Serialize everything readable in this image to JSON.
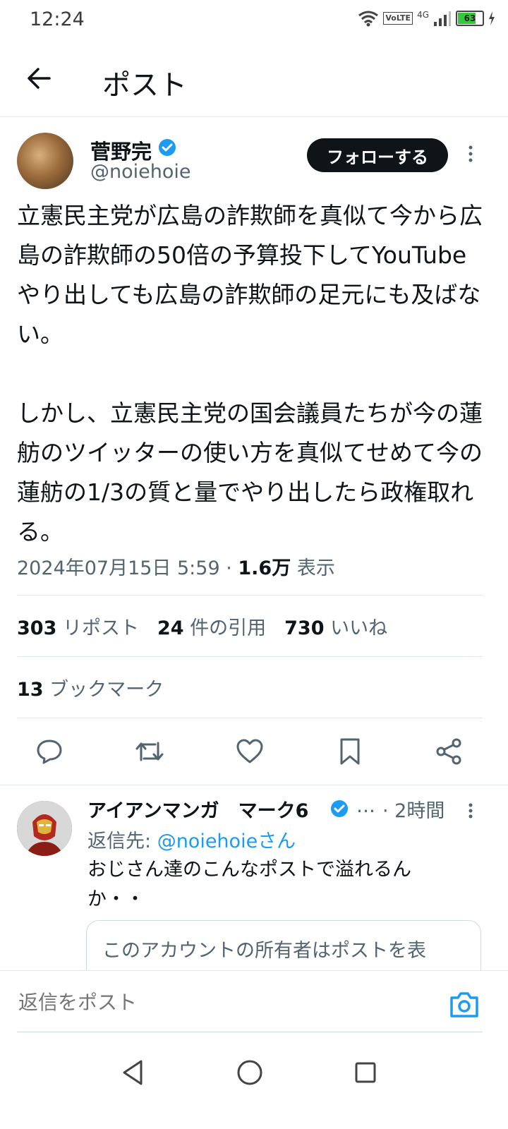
{
  "status_bar": {
    "time": "12:24",
    "network": "4G",
    "volte": "VoLTE",
    "battery": "63",
    "icons": [
      "wifi-icon",
      "signal-icon",
      "battery-icon",
      "charging-icon"
    ]
  },
  "header": {
    "title": "ポスト",
    "back_icon": "arrow-left-icon"
  },
  "post": {
    "author_name": "菅野完",
    "author_handle": "@noiehoie",
    "follow_label": "フォローする",
    "body": "立憲民主党が広島の詐欺師を真似て今から広島の詐欺師の50倍の予算投下してYouTubeやり出しても広島の詐欺師の足元にも及ばない。\n\nしかし、立憲民主党の国会議員たちが今の蓮舫のツイッターの使い方を真似てせめて今の蓮舫の1/3の質と量でやり出したら政権取れる。",
    "timestamp": "2024年07月15日 5:59",
    "separator": " · ",
    "views_count": "1.6万",
    "views_label": " 表示",
    "reposts_count": "303",
    "reposts_label": " リポスト",
    "quotes_count": "24",
    "quotes_label": " 件の引用",
    "likes_count": "730",
    "likes_label": " いいね",
    "bookmarks_count": "13",
    "bookmarks_label": " ブックマーク"
  },
  "actions": [
    "reply-icon",
    "repost-icon",
    "like-icon",
    "bookmark-icon",
    "share-icon"
  ],
  "reply": {
    "author_name": "アイアンマンガ　マーク6",
    "ellipsis": "…",
    "time": "· 2時間",
    "reply_to_prefix": "返信先: ",
    "reply_to_handle": "@noiehoieさん",
    "text": "おじさん達のこんなポストで溢れるんか・・",
    "card_text": "このアカウントの所有者はポストを表"
  },
  "composer": {
    "placeholder": "返信をポスト"
  },
  "colors": {
    "accent": "#1d9bf0",
    "text": "#0f1419",
    "secondary": "#536471",
    "battery": "#34c83a"
  }
}
